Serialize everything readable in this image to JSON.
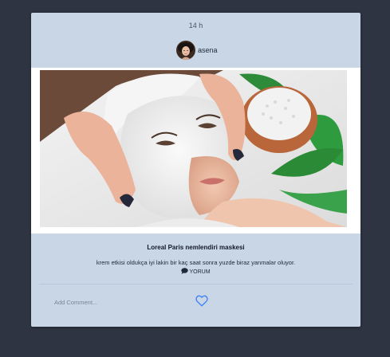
{
  "post": {
    "time": "14 h",
    "username": "asena",
    "title": "Loreal Paris nemlendiri maskesi",
    "description": "krem etkisi oldukça iyi lakin bir kaç saat sonra yuzde biraz yanmalar oluyor.",
    "comment_link": "YORUM"
  },
  "comment": {
    "placeholder": "Add Comment..."
  },
  "icons": {
    "comment": "speech-bubble-icon",
    "like": "heart-outline-icon"
  },
  "colors": {
    "page_background": "#2e3441",
    "card_background": "#c8d6e6",
    "heart_accent": "#3b82f6"
  }
}
